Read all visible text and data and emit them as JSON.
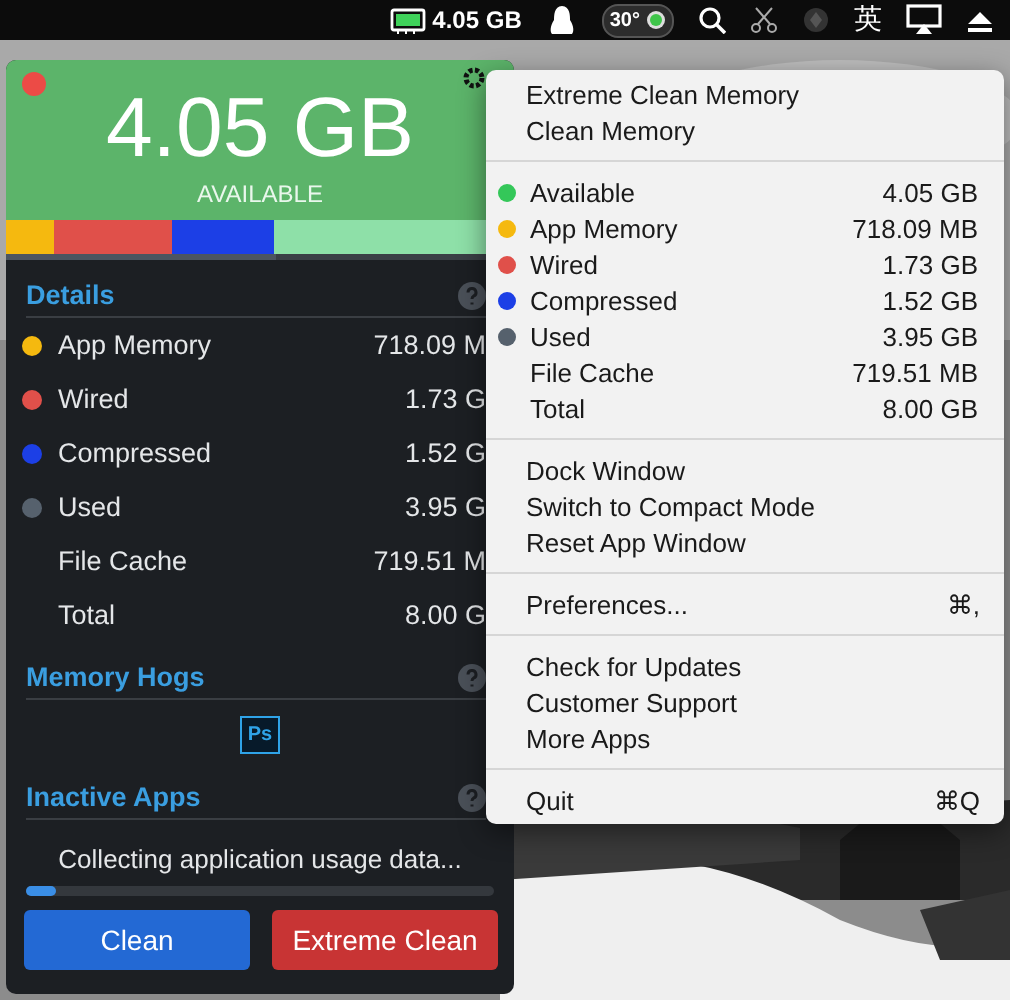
{
  "menu_bar": {
    "memory": "4.05 GB",
    "temperature": "30°",
    "input_method": "英"
  },
  "panel": {
    "available": "4.05 GB",
    "available_label": "AVAILABLE",
    "memory_bar": [
      {
        "color": "#f5b90f"
      },
      {
        "color": "#e0504a"
      },
      {
        "color": "#1c3fe6"
      },
      {
        "color": "#8ee0a8"
      }
    ],
    "used_strip": {
      "level": 0.53
    },
    "details": {
      "title": "Details",
      "rows": [
        {
          "label": "App Memory",
          "value": "718.09 M",
          "color": "#f5b90f"
        },
        {
          "label": "Wired",
          "value": "1.73 G",
          "color": "#e0504a"
        },
        {
          "label": "Compressed",
          "value": "1.52 G",
          "color": "#1c3fe6"
        },
        {
          "label": "Used",
          "value": "3.95 G",
          "color": "#56616d"
        },
        {
          "label": "File Cache",
          "value": "719.51 M"
        },
        {
          "label": "Total",
          "value": "8.00 G"
        }
      ]
    },
    "memory_hogs": {
      "title": "Memory Hogs",
      "apps": [
        {
          "label": "Ps"
        }
      ]
    },
    "inactive_apps": {
      "title": "Inactive Apps",
      "status": "Collecting application usage data...",
      "progress": {
        "level": 0.065
      }
    },
    "buttons": [
      {
        "label": "Clean",
        "kind": "primary"
      },
      {
        "label": "Extreme Clean",
        "kind": "danger"
      }
    ]
  },
  "menu": {
    "sections": [
      {
        "kind": "actions",
        "items": [
          {
            "label": "Extreme Clean Memory"
          },
          {
            "label": "Clean Memory"
          }
        ]
      },
      {
        "kind": "stats",
        "rows": [
          {
            "label": "Available",
            "value": "4.05 GB",
            "color": "#34c759"
          },
          {
            "label": "App Memory",
            "value": "718.09 MB",
            "color": "#f5b90f"
          },
          {
            "label": "Wired",
            "value": "1.73 GB",
            "color": "#e0504a"
          },
          {
            "label": "Compressed",
            "value": "1.52 GB",
            "color": "#1c3fe6"
          },
          {
            "label": "Used",
            "value": "3.95 GB",
            "color": "#56616d"
          },
          {
            "label": "File Cache",
            "value": "719.51 MB"
          },
          {
            "label": "Total",
            "value": "8.00 GB"
          }
        ]
      },
      {
        "kind": "actions",
        "items": [
          {
            "label": "Dock Window"
          },
          {
            "label": "Switch to Compact Mode"
          },
          {
            "label": "Reset App Window"
          }
        ]
      },
      {
        "kind": "actions",
        "items": [
          {
            "label": "Preferences...",
            "shortcut": "⌘,"
          }
        ]
      },
      {
        "kind": "actions",
        "items": [
          {
            "label": "Check for Updates"
          },
          {
            "label": "Customer Support"
          },
          {
            "label": "More Apps"
          }
        ]
      },
      {
        "kind": "actions",
        "items": [
          {
            "label": "Quit",
            "shortcut": "⌘Q"
          }
        ]
      }
    ]
  }
}
